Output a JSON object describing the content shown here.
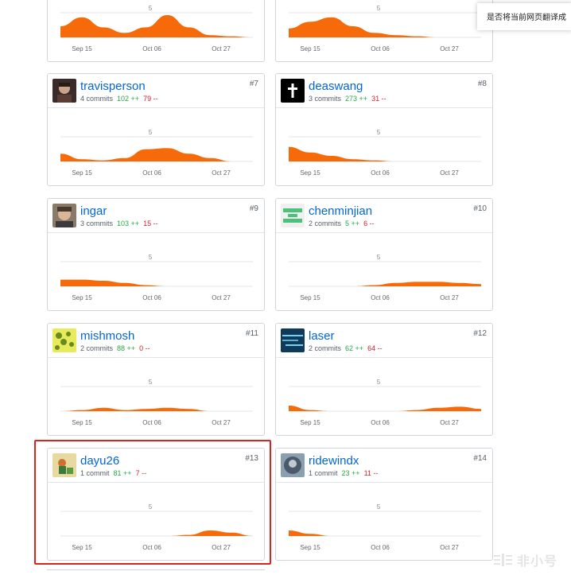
{
  "axis": {
    "mid_label": "5",
    "x_labels": [
      "Sep 15",
      "Oct 06",
      "Oct 27"
    ]
  },
  "cards": [
    {
      "id": "top-left",
      "partial": true,
      "profile": [
        0.5,
        0.9,
        0.45,
        0.2,
        0.45,
        1.0,
        0.45,
        0.1,
        0.05,
        0.0
      ]
    },
    {
      "id": "top-right",
      "partial": true,
      "profile": [
        0.4,
        0.7,
        0.9,
        0.5,
        0.2,
        0.1,
        0.05,
        0.0,
        0.0,
        0.0
      ]
    },
    {
      "id": "c7",
      "username": "travisperson",
      "commits": "4 commits",
      "additions": "102 ++",
      "deletions": "79 --",
      "rank": "#7",
      "avatar": "travisperson-avatar",
      "profile": [
        0.35,
        0.1,
        0.05,
        0.15,
        0.55,
        0.6,
        0.35,
        0.15,
        0.0,
        0.0
      ]
    },
    {
      "id": "c8",
      "username": "deaswang",
      "commits": "3 commits",
      "additions": "273 ++",
      "deletions": "31 --",
      "rank": "#8",
      "avatar": "deaswang-avatar",
      "profile": [
        0.65,
        0.4,
        0.25,
        0.1,
        0.05,
        0.0,
        0.0,
        0.0,
        0.0,
        0.0
      ]
    },
    {
      "id": "c9",
      "username": "ingar",
      "commits": "3 commits",
      "additions": "103 ++",
      "deletions": "15 --",
      "rank": "#9",
      "avatar": "ingar-avatar",
      "profile": [
        0.3,
        0.3,
        0.25,
        0.15,
        0.05,
        0.0,
        0.0,
        0.0,
        0.0,
        0.0
      ]
    },
    {
      "id": "c10",
      "username": "chenminjian",
      "commits": "2 commits",
      "additions": "5 ++",
      "deletions": "6 --",
      "rank": "#10",
      "avatar": "chenminjian-avatar",
      "profile": [
        0.0,
        0.0,
        0.0,
        0.0,
        0.05,
        0.15,
        0.2,
        0.2,
        0.15,
        0.1
      ]
    },
    {
      "id": "c11",
      "username": "mishmosh",
      "commits": "2 commits",
      "additions": "88 ++",
      "deletions": "0 --",
      "rank": "#11",
      "avatar": "mishmosh-avatar",
      "profile": [
        0.0,
        0.05,
        0.15,
        0.05,
        0.1,
        0.15,
        0.1,
        0.0,
        0.0,
        0.0
      ]
    },
    {
      "id": "c12",
      "username": "laser",
      "commits": "2 commits",
      "additions": "62 ++",
      "deletions": "64 --",
      "rank": "#12",
      "avatar": "laser-avatar",
      "profile": [
        0.25,
        0.05,
        0.0,
        0.0,
        0.0,
        0.0,
        0.05,
        0.15,
        0.2,
        0.1
      ]
    },
    {
      "id": "c13",
      "username": "dayu26",
      "commits": "1 commit",
      "additions": "81 ++",
      "deletions": "7 --",
      "rank": "#13",
      "avatar": "dayu26-avatar",
      "profile": [
        0.0,
        0.0,
        0.0,
        0.0,
        0.0,
        0.0,
        0.05,
        0.25,
        0.15,
        0.0
      ]
    },
    {
      "id": "c14",
      "username": "ridewindx",
      "commits": "1 commit",
      "additions": "23 ++",
      "deletions": "11 --",
      "rank": "#14",
      "avatar": "ridewindx-avatar",
      "profile": [
        0.25,
        0.1,
        0.0,
        0.0,
        0.0,
        0.0,
        0.0,
        0.0,
        0.0,
        0.0
      ]
    }
  ],
  "translate_prompt": "是否将当前网页翻译成",
  "watermark": "非小号",
  "colors": {
    "area": "#f66a0a",
    "link": "#0366d6",
    "add": "#28a745",
    "del": "#cb2431",
    "highlight": "#d9251d"
  }
}
